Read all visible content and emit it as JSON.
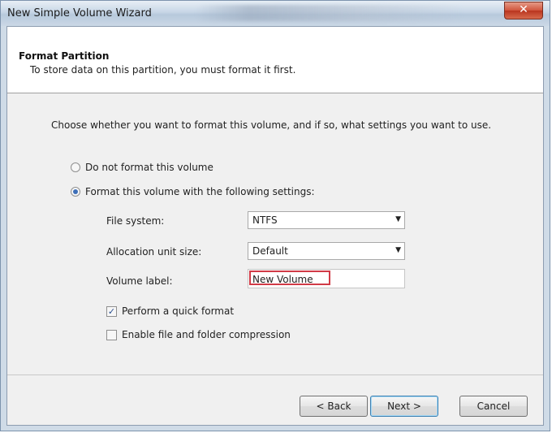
{
  "window": {
    "title": "New Simple Volume Wizard",
    "close_label": "✕"
  },
  "header": {
    "title": "Format Partition",
    "subtitle": "To store data on this partition, you must format it first."
  },
  "intro": "Choose whether you want to format this volume, and if so, what settings you want to use.",
  "options": {
    "no_format": {
      "label": "Do not format this volume",
      "selected": false
    },
    "format": {
      "label": "Format this volume with the following settings:",
      "selected": true
    }
  },
  "settings": {
    "file_system": {
      "label": "File system:",
      "value": "NTFS"
    },
    "allocation": {
      "label": "Allocation unit size:",
      "value": "Default"
    },
    "volume_label": {
      "label": "Volume label:",
      "value": "New Volume"
    }
  },
  "checkboxes": {
    "quick_format": {
      "label": "Perform a quick format",
      "checked": true
    },
    "compression": {
      "label": "Enable file and folder compression",
      "checked": false
    }
  },
  "buttons": {
    "back": "< Back",
    "next": "Next >",
    "cancel": "Cancel"
  },
  "colors": {
    "accent": "#3d6fb8",
    "highlight_border": "#d13b47",
    "close": "#c8452d"
  }
}
